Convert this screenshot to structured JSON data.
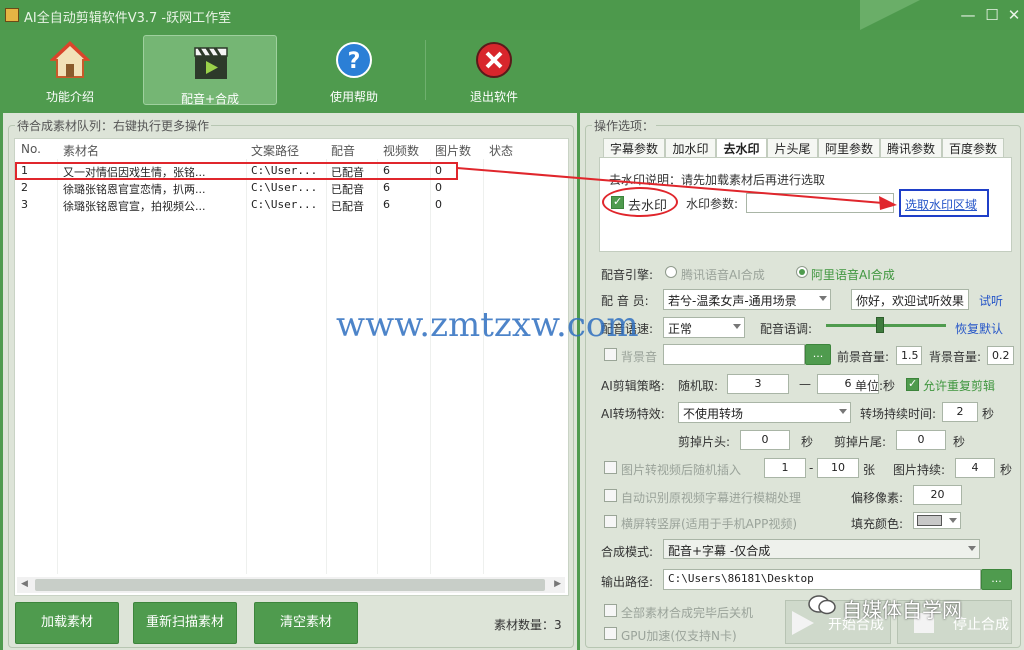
{
  "window": {
    "title": "AI全自动剪辑软件V3.7 -跃网工作室",
    "minimize": "—",
    "maximize": "☐",
    "close": "✕"
  },
  "toolbar": [
    {
      "label": "功能介绍",
      "icon": "home-icon"
    },
    {
      "label": "配音+合成",
      "icon": "clapperboard-icon"
    },
    {
      "label": "使用帮助",
      "icon": "help-icon"
    },
    {
      "label": "退出软件",
      "icon": "exit-icon"
    }
  ],
  "queue": {
    "legend": "待合成素材队列：右键执行更多操作",
    "columns": [
      "No.",
      "素材名",
      "文案路径",
      "配音",
      "视频数",
      "图片数",
      "状态"
    ],
    "rows": [
      [
        "1",
        "又一对情侣因戏生情，张铭...",
        "C:\\User...",
        "已配音",
        "6",
        "0",
        ""
      ],
      [
        "2",
        "徐璐张铭恩官宣恋情，扒两...",
        "C:\\User...",
        "已配音",
        "6",
        "0",
        ""
      ],
      [
        "3",
        "徐璐张铭恩官宣，拍视频公...",
        "C:\\User...",
        "已配音",
        "6",
        "0",
        ""
      ]
    ],
    "buttons": [
      "加载素材",
      "重新扫描素材",
      "清空素材"
    ],
    "count_label": "素材数量：3"
  },
  "ops": {
    "legend": "操作选项：",
    "tabs": [
      "字幕参数",
      "加水印",
      "去水印",
      "片头尾",
      "阿里参数",
      "腾讯参数",
      "百度参数"
    ],
    "active_tab": "去水印",
    "watermark": {
      "desc": "去水印说明：请先加载素材后再进行选取",
      "remove_label": "去水印",
      "param_label": "水印参数:",
      "param_value": "",
      "select_link": "选取水印区域"
    },
    "engine_label": "配音引擎:",
    "engine_options": [
      "腾讯语音AI合成",
      "阿里语音AI合成"
    ],
    "voice_label": "配 音 员:",
    "voice_value": "若兮-温柔女声-通用场景",
    "preview_text": "你好，欢迎试听效果",
    "preview_link": "试听",
    "speed_label": "配音语速:",
    "speed_value": "正常",
    "tone_label": "配音语调:",
    "tone_level": 0.45,
    "restore_link": "恢复默认",
    "bgm_label": "背景音",
    "browse": "...",
    "fg_vol_label": "前景音量:",
    "fg_vol": "1.5",
    "bg_vol_label": "背景音量:",
    "bg_vol": "0.2",
    "strategy_label": "AI剪辑策略:",
    "random_label": "随机取:",
    "rand_min": "3",
    "dash": "—",
    "rand_max": "6",
    "unit_label": "单位:秒",
    "repeat_label": "允许重复剪辑",
    "transition_label": "AI转场特效:",
    "transition_value": "不使用转场",
    "trans_dur_label": "转场持续时间:",
    "trans_dur": "2",
    "sec": "秒",
    "cut_head_label": "剪掉片头:",
    "cut_head": "0",
    "cut_tail_label": "剪掉片尾:",
    "cut_tail": "0",
    "pic_label": "图片转视频后随机插入",
    "pic_min": "1",
    "pic_dash": "-",
    "pic_max": "10",
    "zhang": "张",
    "pic_dur_label": "图片持续:",
    "pic_dur": "4",
    "blur_label": "自动识别原视频字幕进行模糊处理",
    "offset_label": "偏移像素:",
    "offset": "20",
    "portrait_label": "横屏转竖屏(适用于手机APP视频)",
    "fill_label": "填充颜色:",
    "mode_label": "合成模式:",
    "mode_value": "配音+字幕 -仅合成",
    "out_label": "输出路径:",
    "out_value": "C:\\Users\\86181\\Desktop",
    "shutdown_label": "全部素材合成完毕后关机",
    "gpu_label": "GPU加速(仅支持N卡)",
    "start_btn": "开始合成",
    "stop_btn": "停止合成"
  },
  "watermarks": {
    "site": "www.zmtzxw.com",
    "wechat": "自媒体自学网"
  },
  "colors": {
    "accent": "#4f9b4e",
    "highlight": "#e0262c",
    "link": "#2656c8"
  }
}
